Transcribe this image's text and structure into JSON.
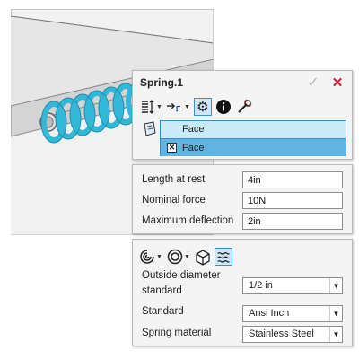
{
  "dialog": {
    "title": "Spring.1",
    "ok_icon": "checkmark-icon",
    "close_icon": "close-icon",
    "toolbar_icons": [
      "spring-type-icon",
      "force-icon",
      "settings-gear-icon",
      "info-icon",
      "tools-icon"
    ],
    "selection": {
      "icon": "face-selection-icon",
      "items": [
        "Face",
        "Face"
      ]
    }
  },
  "params": {
    "length_at_rest": {
      "label": "Length at rest",
      "value": "4in"
    },
    "nominal_force": {
      "label": "Nominal force",
      "value": "10N"
    },
    "max_deflection": {
      "label": "Maximum deflection",
      "value": "2in"
    }
  },
  "standard": {
    "toolbar_icons": [
      "spring-shape-icon",
      "spring-end-icon",
      "cube-icon",
      "spring-graph-icon"
    ],
    "outside_diameter": {
      "label_line1": "Outside diameter",
      "label_line2": "standard",
      "value": "1/2 in"
    },
    "standard": {
      "label": "Standard",
      "value": "Ansi Inch"
    },
    "material": {
      "label": "Spring material",
      "value": "Stainless Steel"
    }
  },
  "colors": {
    "spring": "#33b8d8",
    "accent": "#3d8fd0",
    "close": "#d8182a"
  }
}
